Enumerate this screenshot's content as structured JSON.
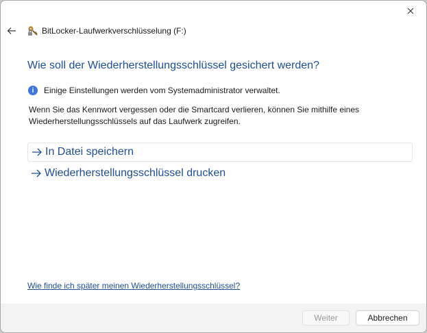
{
  "window": {
    "title": "BitLocker-Laufwerkverschlüsselung (F:)",
    "close_icon": "close-icon",
    "back_icon": "back-arrow-icon",
    "title_icon": "bitlocker-key-icon"
  },
  "main": {
    "heading": "Wie soll der Wiederherstellungsschlüssel gesichert werden?",
    "info_text": "Einige Einstellungen werden vom Systemadministrator verwaltet.",
    "description": "Wenn Sie das Kennwort vergessen oder die Smartcard verlieren, können Sie mithilfe eines Wiederherstellungsschlüssels auf das Laufwerk zugreifen.",
    "options": [
      {
        "label": "In Datei speichern"
      },
      {
        "label": "Wiederherstellungsschlüssel drucken"
      }
    ],
    "help_link": "Wie finde ich später meinen Wiederherstellungsschlüssel?"
  },
  "footer": {
    "next_label": "Weiter",
    "cancel_label": "Abbrechen"
  },
  "colors": {
    "accent": "#1f4e97",
    "info": "#3b78d8"
  }
}
